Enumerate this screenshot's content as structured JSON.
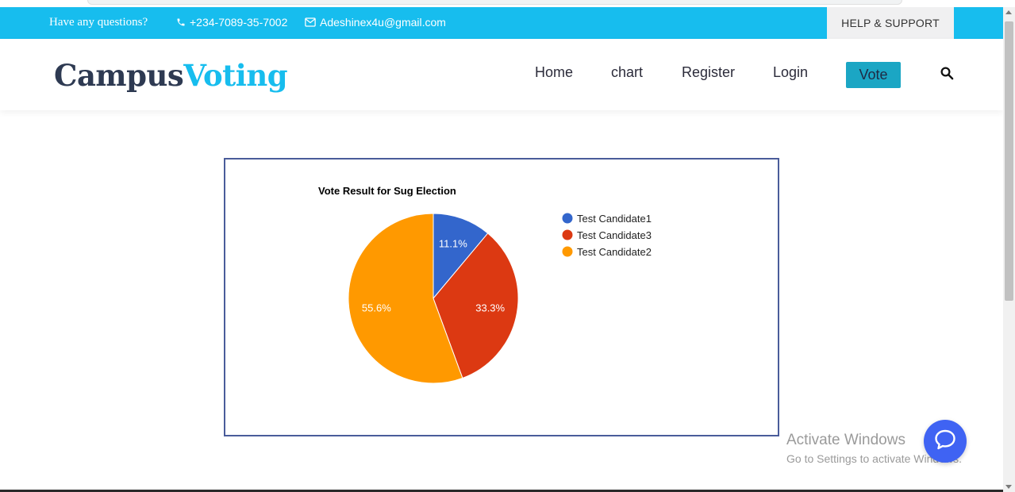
{
  "topbar": {
    "question": "Have any questions?",
    "phone": "+234-7089-35-7002",
    "email": "Adeshinex4u@gmail.com",
    "help": "HELP & SUPPORT"
  },
  "header": {
    "logo_part1": "Campus",
    "logo_part2": "Voting",
    "nav": {
      "home": "Home",
      "chart": "chart",
      "register": "Register",
      "login": "Login",
      "vote": "Vote"
    }
  },
  "chart_data": {
    "type": "pie",
    "title": "Vote Result for Sug Election",
    "legend_position": "right",
    "slices": [
      {
        "label": "Test Candidate1",
        "percent": 11.1,
        "label_text": "11.1%",
        "color": "#3366cc"
      },
      {
        "label": "Test Candidate3",
        "percent": 33.3,
        "label_text": "33.3%",
        "color": "#dc3912"
      },
      {
        "label": "Test Candidate2",
        "percent": 55.6,
        "label_text": "55.6%",
        "color": "#ff9900"
      }
    ]
  },
  "overlay": {
    "activate_title": "Activate Windows",
    "activate_sub": "Go to Settings to activate Windows."
  },
  "colors": {
    "topbar_bg": "#17bdee",
    "logo_dark": "#2e3a52",
    "logo_accent": "#17bdee",
    "vote_button": "#1ba6c4",
    "chat_button": "#3f63f3"
  },
  "icons": {
    "phone": "phone-icon",
    "email": "envelope-icon",
    "search": "search-icon",
    "chat": "chat-bubble-icon"
  }
}
